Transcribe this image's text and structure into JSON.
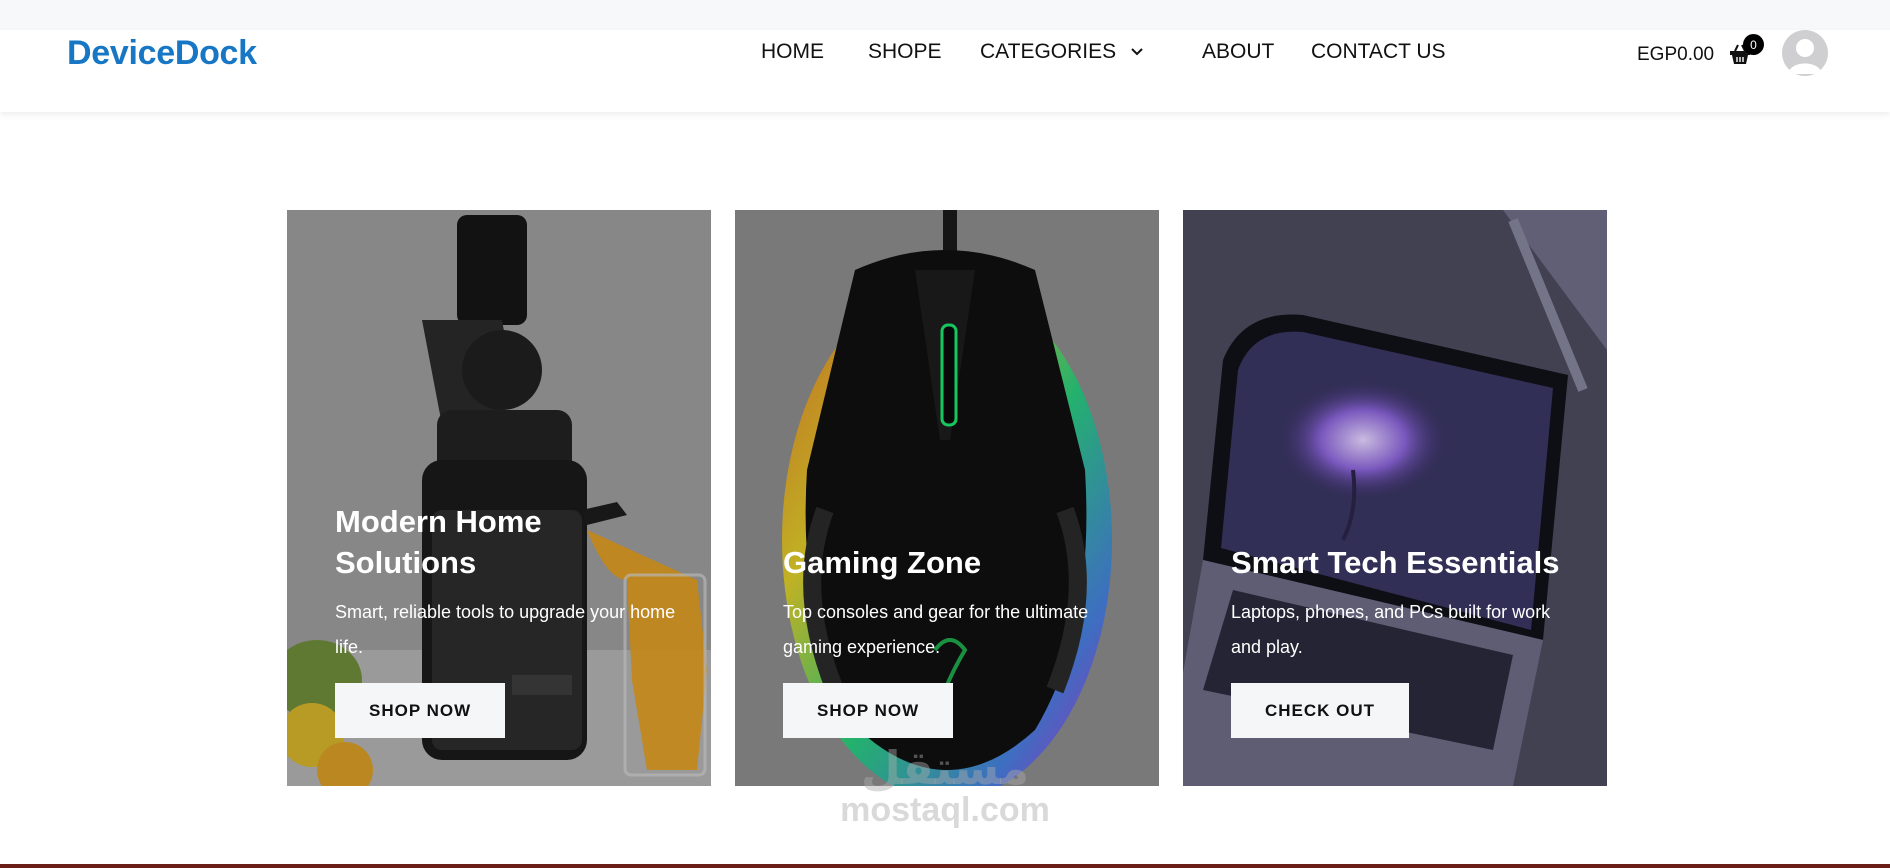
{
  "brand": {
    "logo": "DeviceDock",
    "color": "#1877c5"
  },
  "nav": {
    "items": [
      {
        "label": "HOME"
      },
      {
        "label": "SHOPE"
      },
      {
        "label": "CATEGORIES",
        "has_dropdown": true
      },
      {
        "label": "ABOUT"
      },
      {
        "label": "CONTACT US"
      }
    ]
  },
  "header_right": {
    "price": "EGP0.00",
    "cart_count": "0",
    "cart_icon": "shopping-basket-icon",
    "avatar_icon": "user-avatar-icon"
  },
  "cards": [
    {
      "title": "Modern Home Solutions",
      "description": "Smart, reliable tools to upgrade your home life.",
      "button": "SHOP NOW",
      "image": "juicer-with-orange-juice"
    },
    {
      "title": "Gaming Zone",
      "description": "Top consoles and gear for the ultimate gaming experience.",
      "button": "SHOP NOW",
      "image": "rgb-gaming-mouse"
    },
    {
      "title": "Smart Tech Essentials",
      "description": "Laptops, phones, and PCs built for work and play.",
      "button": "CHECK OUT",
      "image": "laptop-purple-screen"
    }
  ],
  "watermark": {
    "arabic": "مستقل",
    "latin": "mostaql.com"
  }
}
